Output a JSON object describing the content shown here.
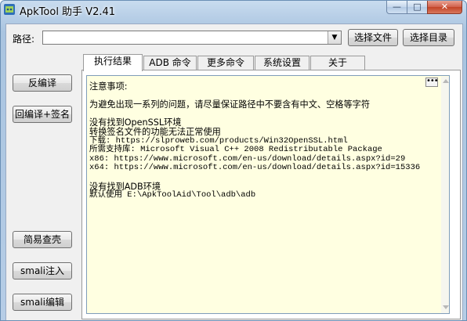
{
  "window": {
    "title": "ApkTool 助手 V2.41"
  },
  "path": {
    "label": "路径:",
    "value": ""
  },
  "buttons": {
    "select_file": "选择文件",
    "select_dir": "选择目录",
    "decompile": "反编译",
    "recompile_sign": "回编译+签名",
    "easy_shell": "简易查壳",
    "smali_inject": "smali注入",
    "smali_edit": "smali编辑"
  },
  "tabs": [
    "执行结果",
    "ADB 命令",
    "更多命令",
    "系统设置",
    "关于"
  ],
  "log": {
    "lines": [
      "注意事项:",
      "",
      "为避免出现一系列的问题，请尽量保证路径中不要含有中文、空格等字符",
      "",
      "没有找到OpenSSL环境",
      "转换签名文件的功能无法正常使用",
      "下载: https://slproweb.com/products/Win32OpenSSL.html",
      "所需支持库: Microsoft Visual C++ 2008 Redistributable Package",
      "x86: https://www.microsoft.com/en-us/download/details.aspx?id=29",
      "x64: https://www.microsoft.com/en-us/download/details.aspx?id=15336",
      "",
      "没有找到ADB环境",
      "默认使用 E:\\ApkToolAid\\Tool\\adb\\adb"
    ]
  },
  "window_controls": {
    "minimize": "—",
    "maximize": "□",
    "close": "✕"
  },
  "icons": {
    "app": "apk-tool-app-icon",
    "dropdown": "chevron-down-icon",
    "more": "ellipsis-icon"
  }
}
